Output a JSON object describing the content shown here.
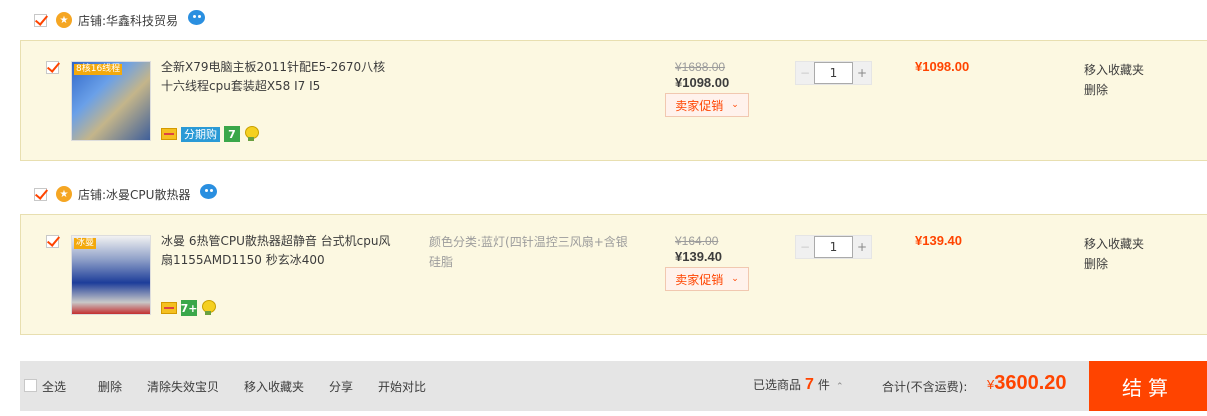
{
  "shops": [
    {
      "label": "店铺:",
      "name": "华鑫科技贸易",
      "items": [
        {
          "title": "全新X79电脑主板2011针配E5-2670八核十六线程cpu套装超X58 I7 I5",
          "image_tag": "8核16线程",
          "sku": "",
          "badges": {
            "fenqi": "分期购",
            "seven": "7"
          },
          "old_price": "¥1688.00",
          "new_price": "¥1098.00",
          "promo": "卖家促销",
          "quantity": "1",
          "total": "¥1098.00",
          "ops": {
            "fav": "移入收藏夹",
            "del": "删除"
          }
        }
      ]
    },
    {
      "label": "店铺:",
      "name": "冰曼CPU散热器",
      "items": [
        {
          "title": "冰曼 6热管CPU散热器超静音 台式机cpu风扇1155AMD1150 秒玄冰400",
          "image_tag": "冰曼",
          "sku": "颜色分类:蓝灯(四针温控三风扇+含银硅脂",
          "badges": {
            "seven": "7+"
          },
          "old_price": "¥164.00",
          "new_price": "¥139.40",
          "promo": "卖家促销",
          "quantity": "1",
          "total": "¥139.40",
          "ops": {
            "fav": "移入收藏夹",
            "del": "删除"
          }
        }
      ]
    }
  ],
  "footer": {
    "select_all": "全选",
    "delete": "删除",
    "clear_invalid": "清除失效宝贝",
    "move_fav": "移入收藏夹",
    "share": "分享",
    "compare": "开始对比",
    "selected_prefix": "已选商品",
    "selected_count": "7",
    "selected_suffix": "件",
    "sum_label": "合计(不含运费):",
    "currency": "¥",
    "sum_amount": "3600.20",
    "checkout": "结算"
  },
  "colors": {
    "accent": "#ff4400",
    "item_bg": "#fcf8e1",
    "footer_bg": "#e5e5e5"
  }
}
